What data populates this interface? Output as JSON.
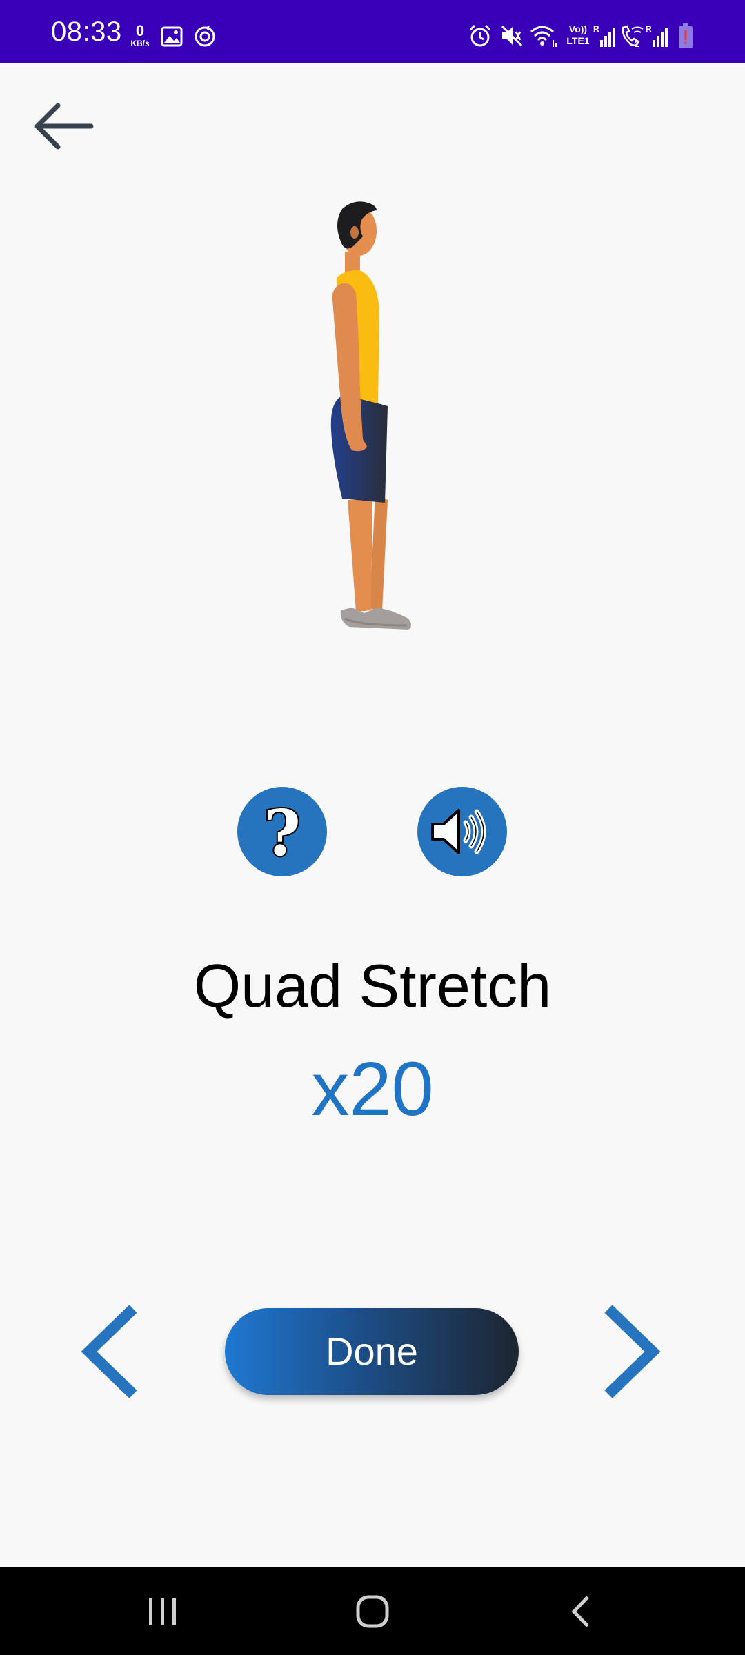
{
  "status_bar": {
    "time": "08:33",
    "net_speed_value": "0",
    "net_speed_unit": "KB/s",
    "lte_label": "Vo)) LTE1",
    "background_color": "#3a00b8",
    "icons": [
      "gallery-icon",
      "sync-icon",
      "alarm-icon",
      "mute-icon",
      "wifi-icon",
      "signal-icon",
      "call-wifi-icon",
      "signal-icon-2",
      "battery-icon"
    ]
  },
  "header": {
    "back_icon": "arrow-left-icon"
  },
  "exercise": {
    "name": "Quad Stretch",
    "reps": "x20",
    "help_icon": "question-icon",
    "sound_icon": "speaker-icon"
  },
  "controls": {
    "done_label": "Done",
    "previous_icon": "chevron-left-icon",
    "next_icon": "chevron-right-icon"
  },
  "colors": {
    "accent": "#2674be",
    "reps_text": "#1f74c6"
  },
  "system_nav": {
    "icons": [
      "recent-apps-icon",
      "home-icon",
      "back-nav-icon"
    ]
  }
}
